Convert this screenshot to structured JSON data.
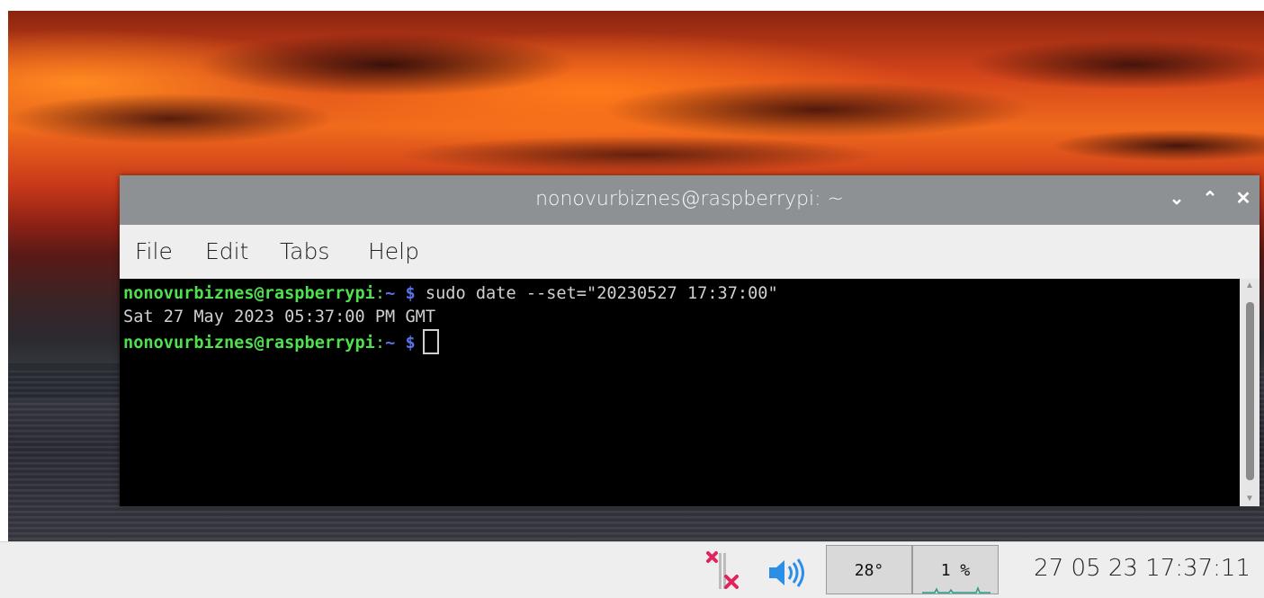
{
  "terminal": {
    "title": "nonovurbiznes@raspberrypi: ~",
    "controls": {
      "minimize": "⌄",
      "maximize": "⌃",
      "close": "✕"
    },
    "menu": [
      "File",
      "Edit",
      "Tabs",
      "Help"
    ],
    "lines": [
      {
        "user": "nonovurbiznes@raspberrypi",
        "sep": ":",
        "path": "~",
        "dollar": "$",
        "command": "sudo date --set=\"20230527 17:37:00\""
      },
      {
        "output": "Sat 27 May 2023 05:37:00 PM GMT"
      },
      {
        "user": "nonovurbiznes@raspberrypi",
        "sep": ":",
        "path": "~",
        "dollar": "$",
        "command": ""
      }
    ]
  },
  "taskbar": {
    "network_icon": "network-disconnected-icon",
    "volume_icon": "speaker-volume-icon",
    "temperature": "28°",
    "cpu": "1 %",
    "clock": "27 05 23 17:37:11"
  },
  "colors": {
    "prompt_user": "#4ee04e",
    "prompt_path": "#5a72e8",
    "titlebar": "#8e9194",
    "network_x": "#e0245e",
    "volume": "#2b8fe8"
  }
}
